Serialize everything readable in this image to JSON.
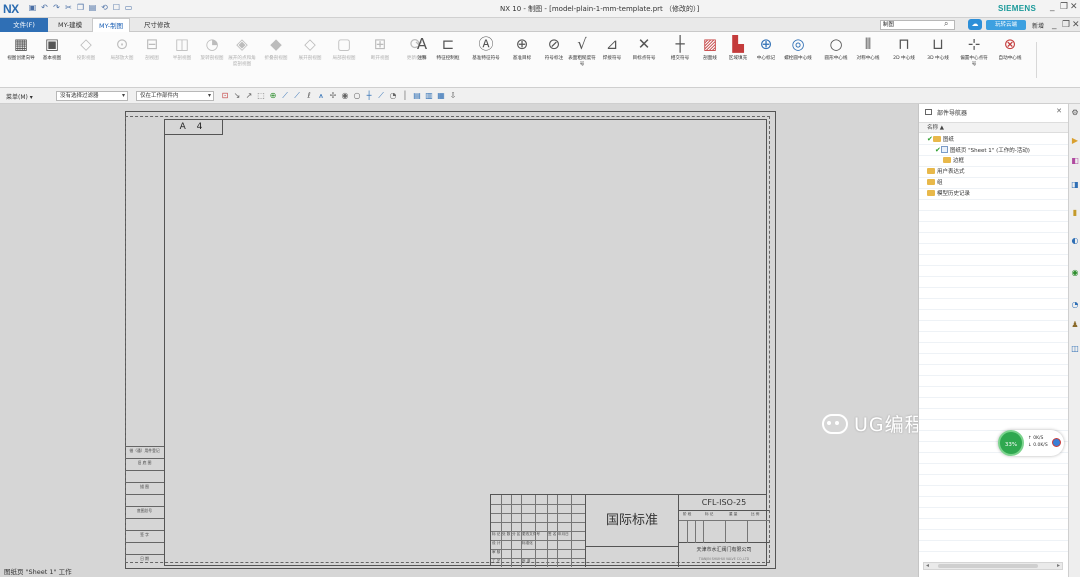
{
  "app": {
    "logo": "NX",
    "title": "NX 10 - 制图 - [model-plain-1-mm-template.prt （修改的）]",
    "brand": "SIEMENS"
  },
  "tabs": [
    {
      "label": "文件(F)"
    },
    {
      "label": "MY-建模"
    },
    {
      "label": "MY-制图"
    },
    {
      "label": "尺寸修改"
    }
  ],
  "topbar": {
    "search_value": "制图",
    "help_label": "玩转云端",
    "new_label": "新增"
  },
  "ribbon": [
    {
      "label": "视图创建向导",
      "icon": "▦",
      "state": "normal"
    },
    {
      "label": "基本视图",
      "icon": "▣",
      "state": "normal"
    },
    {
      "label": "投影视图",
      "icon": "◇",
      "state": "dim"
    },
    {
      "label": "局部放大图",
      "icon": "⊙",
      "state": "dim"
    },
    {
      "label": "剖视图",
      "icon": "⊟",
      "state": "dim"
    },
    {
      "label": "半剖视图",
      "icon": "◫",
      "state": "dim"
    },
    {
      "label": "旋转剖视图",
      "icon": "◔",
      "state": "dim"
    },
    {
      "label": "展开的点和角度剖视图",
      "icon": "◈",
      "state": "dim"
    },
    {
      "label": "折叠剖视图",
      "icon": "◆",
      "state": "dim"
    },
    {
      "label": "展开剖视图",
      "icon": "◇",
      "state": "dim"
    },
    {
      "label": "局部剖视图",
      "icon": "▢",
      "state": "dim"
    },
    {
      "label": "断开视图",
      "icon": "⊞",
      "state": "dim"
    },
    {
      "label": "更新视图",
      "icon": "⟳",
      "state": "dim"
    },
    {
      "label": "注释",
      "icon": "A",
      "state": "normal"
    },
    {
      "label": "特征控制框",
      "icon": "⊏",
      "state": "normal"
    },
    {
      "label": "基准特征符号",
      "icon": "Ⓐ",
      "state": "normal"
    },
    {
      "label": "基准目标",
      "icon": "⊕",
      "state": "normal"
    },
    {
      "label": "符号标注",
      "icon": "⊘",
      "state": "normal"
    },
    {
      "label": "表面粗糙度符号",
      "icon": "√",
      "state": "normal"
    },
    {
      "label": "焊接符号",
      "icon": "⊿",
      "state": "normal"
    },
    {
      "label": "目标点符号",
      "icon": "✕",
      "state": "normal"
    },
    {
      "label": "相交符号",
      "icon": "┼",
      "state": "normal"
    },
    {
      "label": "剖面线",
      "icon": "▨",
      "state": "red"
    },
    {
      "label": "区域填充",
      "icon": "▙",
      "state": "red"
    },
    {
      "label": "中心标记",
      "icon": "⊕",
      "state": "blue"
    },
    {
      "label": "螺栓圆中心线",
      "icon": "◎",
      "state": "blue"
    },
    {
      "label": "圆形中心线",
      "icon": "○",
      "state": "normal"
    },
    {
      "label": "对称中心线",
      "icon": "⫴",
      "state": "normal"
    },
    {
      "label": "2D 中心线",
      "icon": "⊓",
      "state": "normal"
    },
    {
      "label": "3D 中心线",
      "icon": "⊔",
      "state": "normal"
    },
    {
      "label": "偏置中心点符号",
      "icon": "⊹",
      "state": "normal"
    },
    {
      "label": "自动中心线",
      "icon": "⊗",
      "state": "red"
    }
  ],
  "toolbar2": {
    "menu_label": "菜单(M) ▾",
    "selection_filter": "没有选择过滤器",
    "scope": "仅在工作部件内"
  },
  "drawing": {
    "sheet_size": "A 4",
    "standard": "国际标准",
    "code": "CFL-ISO-25",
    "company": "天津市水汇阀门有限公司",
    "company_en": "TIANJIN SHUIHUI VALVE CO.,LTD",
    "left_strip": [
      "借（通）用件登记",
      "旧 底 图",
      "",
      "描 图",
      "",
      "底图总号",
      "",
      "签 字",
      "",
      "日 期"
    ],
    "mini_labels": [
      "阶 段",
      "标 记",
      "重 量",
      "比 例"
    ],
    "grid_labels": [
      "标 记",
      "处 数",
      "分 区",
      "更改文件号",
      "签 名",
      "年月日",
      "设 计",
      "标准化",
      "审 核",
      "工 艺",
      "批 准"
    ]
  },
  "navigator": {
    "title": "部件导航器",
    "column": "名称",
    "rows": [
      {
        "label": "图纸",
        "level": 0,
        "kind": "check-folder"
      },
      {
        "label": "图纸页 \"Sheet 1\" (工作的-活动)",
        "level": 1,
        "kind": "check-sheet"
      },
      {
        "label": "边框",
        "level": 2,
        "kind": "folder"
      },
      {
        "label": "用户表达式",
        "level": 0,
        "kind": "folder"
      },
      {
        "label": "组",
        "level": 0,
        "kind": "folder"
      },
      {
        "label": "模型历史记录",
        "level": 0,
        "kind": "folder"
      }
    ]
  },
  "performance": {
    "percent": "33%",
    "up": "0K/S",
    "down": "0.0K/S"
  },
  "status_text": "图纸页 \"Sheet 1\" 工作",
  "watermark": "UG编程小助手"
}
